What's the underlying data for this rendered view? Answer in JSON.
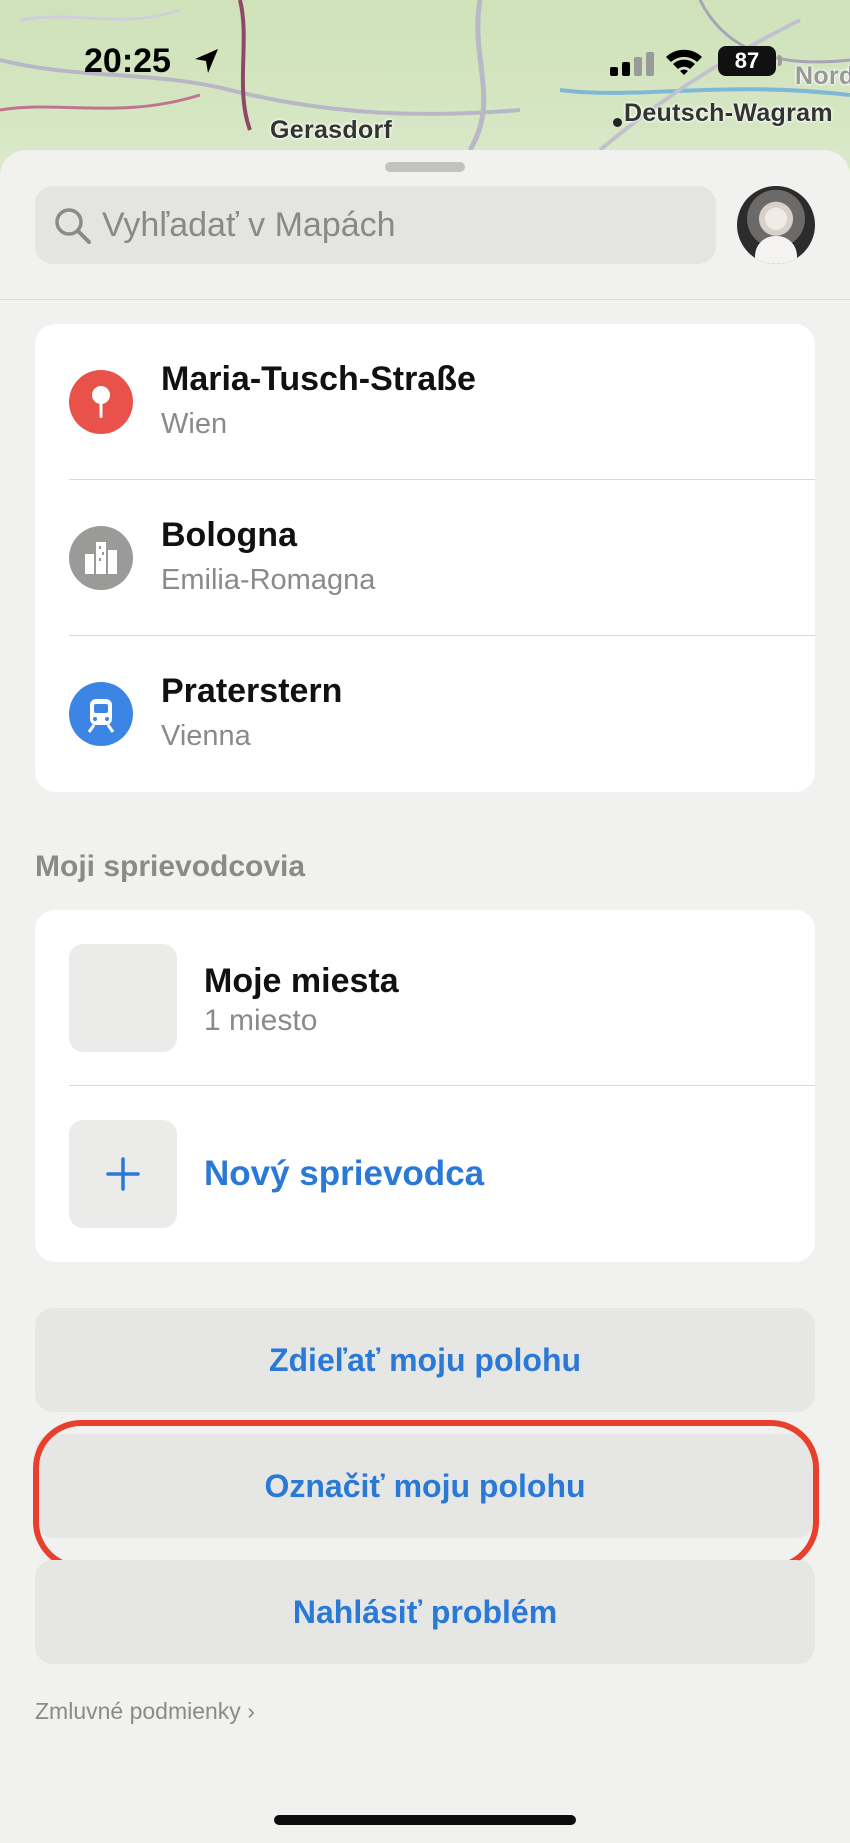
{
  "status_bar": {
    "time": "20:25",
    "battery": "87",
    "icons": [
      "location-arrow-icon",
      "cellular-signal-icon",
      "wifi-icon",
      "battery-icon"
    ]
  },
  "map": {
    "labels": [
      "Gerasdorf",
      "Deutsch-Wagram",
      "Nord"
    ]
  },
  "search": {
    "placeholder": "Vyhľadať v Mapách"
  },
  "recents": [
    {
      "title": "Maria-Tusch-Straße",
      "subtitle": "Wien",
      "icon": "pin-icon",
      "icon_color": "#e9524a"
    },
    {
      "title": "Bologna",
      "subtitle": "Emilia-Romagna",
      "icon": "city-icon",
      "icon_color": "#9a9a98"
    },
    {
      "title": "Praterstern",
      "subtitle": "Vienna",
      "icon": "tram-icon",
      "icon_color": "#3c85e4"
    }
  ],
  "guides": {
    "section_title": "Moji sprievodcovia",
    "items": [
      {
        "title": "Moje miesta",
        "subtitle": "1 miesto"
      }
    ],
    "new_guide_label": "Nový sprievodca"
  },
  "actions": {
    "share_location": "Zdieľať moju polohu",
    "mark_location": "Označiť moju polohu",
    "report_problem": "Nahlásiť problém"
  },
  "footer": {
    "terms": "Zmluvné podmienky",
    "terms_chevron": "›"
  },
  "colors": {
    "accent": "#2b79d6",
    "highlight": "#e8402c"
  }
}
